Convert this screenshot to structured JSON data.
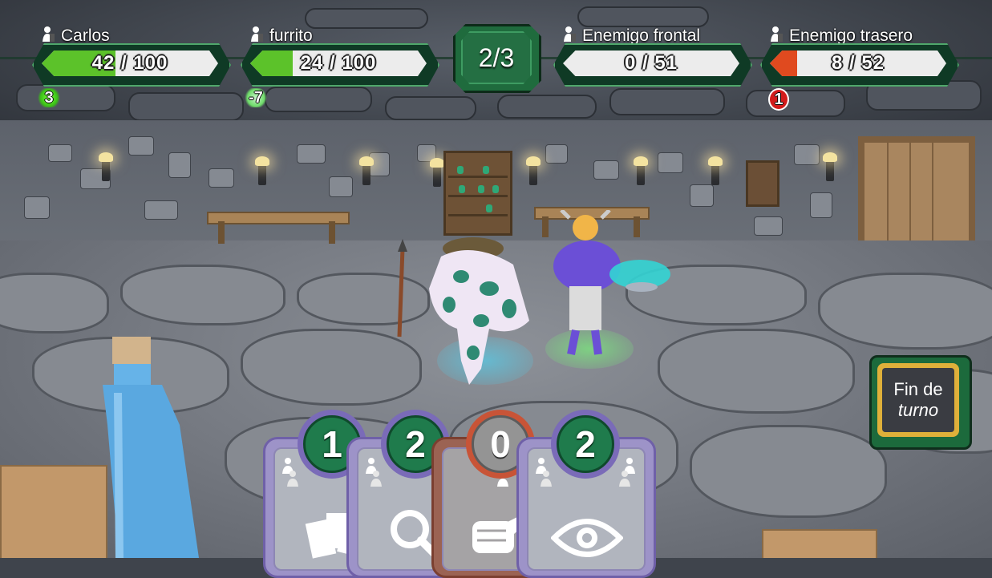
{
  "hud": {
    "allies": [
      {
        "name": "Carlos",
        "hp": "42 / 100",
        "hp_fraction": 0.42,
        "bar_color": "#5cc22a",
        "status": "3",
        "status_kind": "regen"
      },
      {
        "name": "furrito",
        "hp": "24 / 100",
        "hp_fraction": 0.24,
        "bar_color": "#5cc22a",
        "status": "-7",
        "status_kind": "poison"
      }
    ],
    "round": "2/3",
    "enemies": [
      {
        "name": "Enemigo frontal",
        "hp": "0 / 51",
        "hp_fraction": 0.0,
        "bar_color": "#e04a1f"
      },
      {
        "name": "Enemigo trasero",
        "hp": "8 / 52",
        "hp_fraction": 0.154,
        "bar_color": "#e04a1f",
        "status": "1",
        "status_kind": "bleed"
      }
    ]
  },
  "end_turn": {
    "line1": "Fin de",
    "line2": "turno"
  },
  "cards": [
    {
      "cost": "1",
      "icon": "cards-icon",
      "state": "playable"
    },
    {
      "cost": "2",
      "icon": "magnifier-icon",
      "state": "playable"
    },
    {
      "cost": "0",
      "icon": "punch-fist-icon",
      "state": "disabled"
    },
    {
      "cost": "2",
      "icon": "eye-icon",
      "state": "playable"
    }
  ],
  "colors": {
    "hud_green": "#1f6b3d",
    "ally_fill": "#5cc22a",
    "enemy_fill": "#e04a1f",
    "card_frame": "#9d93c8",
    "end_turn_gold": "#dfb03a"
  }
}
